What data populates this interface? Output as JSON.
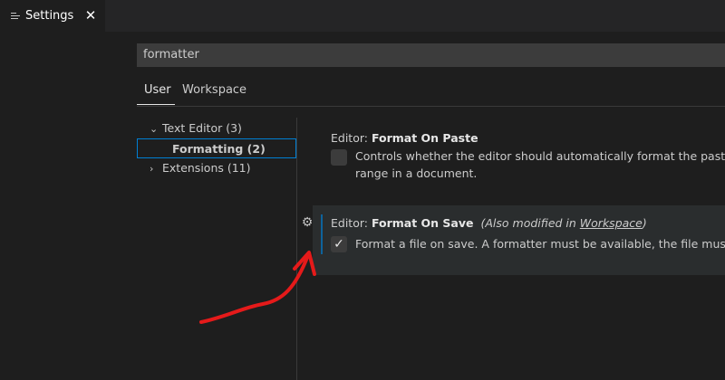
{
  "tab": {
    "title": "Settings",
    "close": "✕"
  },
  "search": {
    "value": "formatter"
  },
  "scope_tabs": [
    {
      "label": "User"
    },
    {
      "label": "Workspace"
    }
  ],
  "toc": {
    "text_editor": "Text Editor (3)",
    "formatting": "Formatting (2)",
    "extensions": "Extensions (11)"
  },
  "settings": [
    {
      "category": "Editor: ",
      "name": "Format On Paste",
      "checked": false,
      "description_lines": [
        "Controls whether the editor should automatically format the pasted con",
        "range in a document."
      ]
    },
    {
      "category": "Editor: ",
      "name": "Format On Save",
      "modified_prefix": "(Also modified in ",
      "modified_link": "Workspace",
      "modified_suffix": ")",
      "checked": true,
      "description_lines": [
        "Format a file on save. A formatter must be available, the file must not be"
      ]
    }
  ],
  "colors": {
    "accent": "#007fd4",
    "annotation_arrow": "#e51a1a"
  }
}
